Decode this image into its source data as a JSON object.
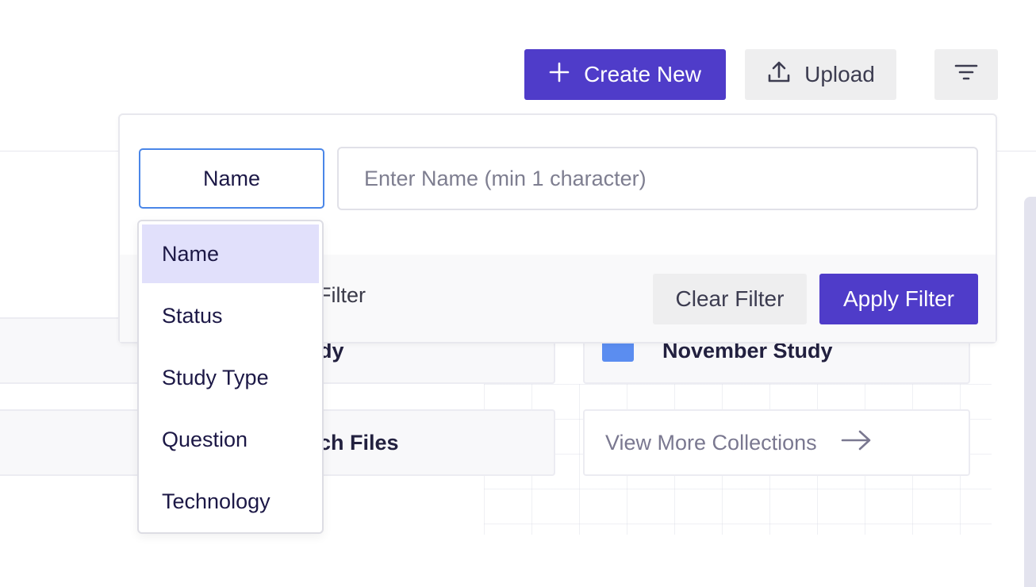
{
  "toolbar": {
    "create_label": "Create New",
    "upload_label": "Upload"
  },
  "cards": [
    {
      "label": "dy"
    },
    {
      "label": "ch Files"
    },
    {
      "label": "November Study"
    },
    {
      "label": "View More Collections"
    }
  ],
  "filter_panel": {
    "field_selected": "Name",
    "input_placeholder": "Enter Name (min 1 character)",
    "input_value": "",
    "footer_label": "Filter",
    "clear_label": "Clear Filter",
    "apply_label": "Apply Filter"
  },
  "dropdown": {
    "options": [
      {
        "label": "Name",
        "selected": true
      },
      {
        "label": "Status",
        "selected": false
      },
      {
        "label": "Study Type",
        "selected": false
      },
      {
        "label": "Question",
        "selected": false
      },
      {
        "label": "Technology",
        "selected": false
      }
    ]
  },
  "colors": {
    "primary": "#4f3cc9",
    "secondary_button": "#eeeeef",
    "selected_option": "#e1e0fb",
    "focus_border": "#4a86e8",
    "folder_icon": "#5b8df0"
  },
  "icons": {
    "create": "plus-icon",
    "upload": "upload-icon",
    "filter_toggle": "filter-lines-icon",
    "view_more": "arrow-right-icon",
    "collection": "folder-icon"
  }
}
